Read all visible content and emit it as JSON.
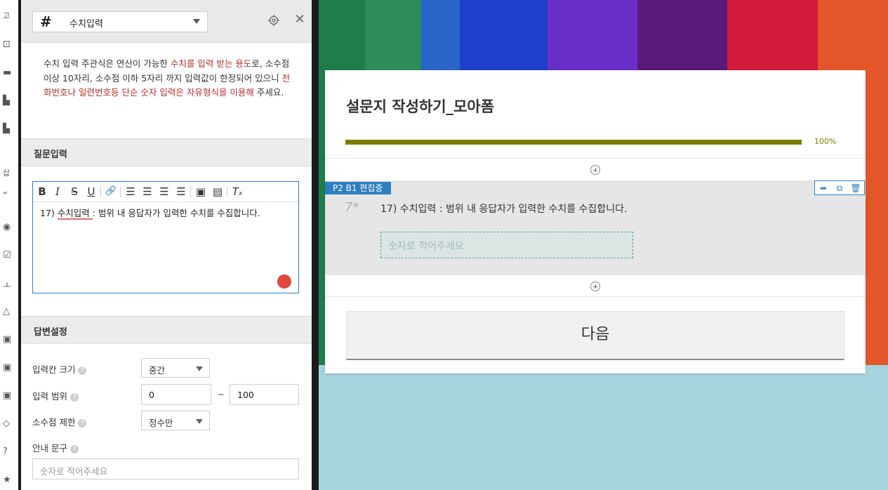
{
  "panel": {
    "type_select": {
      "icon": "hash-icon",
      "label": "수치입력"
    },
    "help_text": {
      "p1": "수치 입력 주관식은 연산이 가능한 ",
      "p2": "수치를 입력 받는 용도",
      "p3": "로, 소수점 이상 10자리, 소수점 이하 5자리 까지 입력값이 한정되어 있으니 ",
      "p4": "전화번호나 일련번호등 단순 숫자 입력은 자유형식을 이용해",
      "p5": " 주세요."
    },
    "question_section": {
      "title": "질문입력",
      "editor_text_prefix": "17) ",
      "editor_text_underlined": "수치입력 ",
      "editor_text_rest": ": 범위 내 응답자가 입력한 수치를 수집합니다."
    },
    "answer_section": {
      "title": "답변설정",
      "input_size_label": "입력칸 크기",
      "input_size_value": "중간",
      "range_label": "입력 범위",
      "range_min": "0",
      "range_sep": "~",
      "range_max": "100",
      "decimal_label": "소수점 제한",
      "decimal_value": "정수만",
      "guide_label": "안내 문구",
      "guide_placeholder": "숫자로 적어주세요",
      "help_mark": "?"
    }
  },
  "left_strip": {
    "top_text": "고",
    "mid_text": "삽"
  },
  "form": {
    "title": "설문지 작성하기_모아폼",
    "progress": {
      "value": 1.0,
      "label": "100%",
      "color": "#7d7d00"
    },
    "edit_tag": "P2 B1 편집중",
    "question": {
      "number": "7*",
      "text": "17) 수치입력 : 범위 내 응답자가 입력한 수치를 수집합니다.",
      "placeholder": "숫자로 적어주세요"
    },
    "next_button": "다음"
  },
  "colors": {
    "accent_blue": "#2d7fc0",
    "progress_olive": "#7d7d00",
    "help_red": "#b52f2f"
  }
}
